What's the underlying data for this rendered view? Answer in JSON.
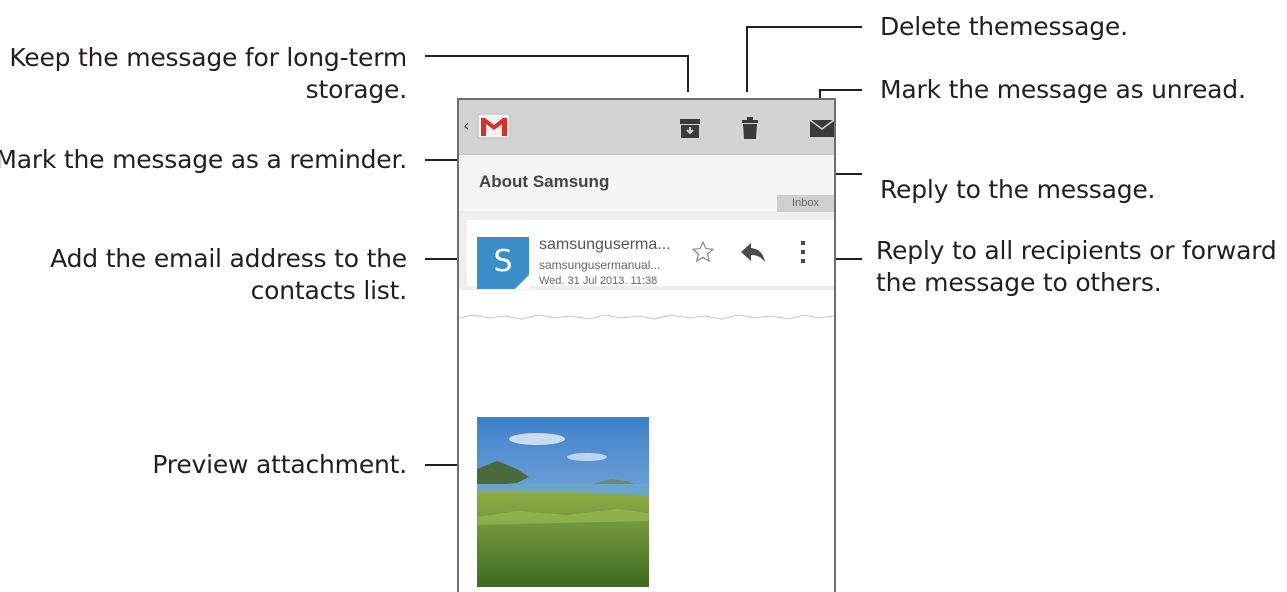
{
  "callouts": {
    "archive": [
      "Keep the message for long-term",
      "storage."
    ],
    "delete": "Delete themessage.",
    "unread": "Mark the message as unread.",
    "reminder": "Mark the message as a reminder.",
    "reply": "Reply to the message.",
    "more": [
      "Reply to all recipients or forward",
      "the message to others."
    ],
    "contact": [
      "Add the email address to the",
      "contacts list."
    ],
    "attachment": "Preview attachment."
  },
  "email": {
    "back_glyph": "‹",
    "subject": "About Samsung",
    "folder_label": "Inbox",
    "avatar_letter": "S",
    "sender_name": "samsungusermа...",
    "sender_email": "samsungusermanual...",
    "date": "Wed. 31 Jul 2013. 11:38"
  },
  "icons": {
    "app": "gmail-icon",
    "actions": [
      "archive-icon",
      "trash-icon",
      "mark-unread-icon"
    ],
    "header": [
      "star-icon",
      "reply-icon",
      "more-vertical-icon"
    ]
  },
  "colors": {
    "action_bar": "#d3d3d3",
    "avatar": "#3b8ec8",
    "icon_dark": "#3a3a3a",
    "gmail_red": "#d93025"
  }
}
